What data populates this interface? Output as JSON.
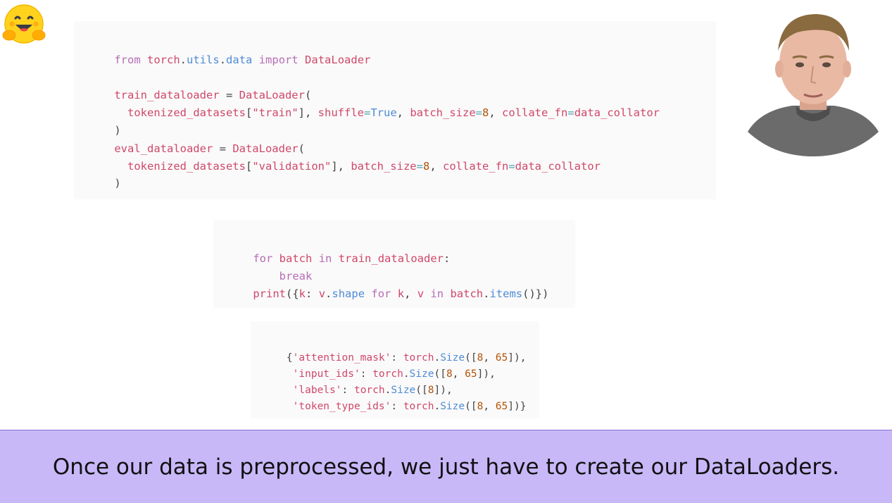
{
  "code_block_1": {
    "line1": [
      "from",
      " ",
      "torch",
      ".",
      "utils",
      ".",
      "data",
      " ",
      "import",
      " ",
      "DataLoader"
    ],
    "line2": [
      "train_dataloader",
      " = ",
      "DataLoader",
      "("
    ],
    "line3": [
      "  ",
      "tokenized_datasets",
      "[",
      "\"train\"",
      "], ",
      "shuffle",
      "=",
      "True",
      ", ",
      "batch_size",
      "=",
      "8",
      ", ",
      "collate_fn",
      "=",
      "data_collator"
    ],
    "line4": [
      ")"
    ],
    "line5": [
      "eval_dataloader",
      " = ",
      "DataLoader",
      "("
    ],
    "line6": [
      "  ",
      "tokenized_datasets",
      "[",
      "\"validation\"",
      "], ",
      "batch_size",
      "=",
      "8",
      ", ",
      "collate_fn",
      "=",
      "data_collator"
    ],
    "line7": [
      ")"
    ]
  },
  "code_block_2": {
    "line1": [
      "for",
      " ",
      "batch",
      " ",
      "in",
      " ",
      "train_dataloader",
      ":"
    ],
    "line2": [
      "    ",
      "break"
    ],
    "line3": [
      "print",
      "({",
      "k",
      ": ",
      "v",
      ".",
      "shape",
      " ",
      "for",
      " ",
      "k",
      ", ",
      "v",
      " ",
      "in",
      " ",
      "batch",
      ".",
      "items",
      "()})"
    ]
  },
  "output_block": {
    "line1": [
      "{",
      "'attention_mask'",
      ": ",
      "torch",
      ".",
      "Size",
      "([",
      "8",
      ", ",
      "65",
      "]),"
    ],
    "line2": [
      " ",
      "'input_ids'",
      ": ",
      "torch",
      ".",
      "Size",
      "([",
      "8",
      ", ",
      "65",
      "]),"
    ],
    "line3": [
      " ",
      "'labels'",
      ": ",
      "torch",
      ".",
      "Size",
      "([",
      "8",
      "]),"
    ],
    "line4": [
      " ",
      "'token_type_ids'",
      ": ",
      "torch",
      ".",
      "Size",
      "([",
      "8",
      ", ",
      "65",
      "])}"
    ]
  },
  "caption": {
    "text": "Once our data is preprocessed, we just have to create our DataLoaders."
  },
  "colors": {
    "keyword": "#b56db5",
    "variable": "#d0476a",
    "function": "#4f8bd6",
    "number": "#b45309",
    "caption_bg": "#c8b8f8"
  },
  "icons": {
    "logo": "hugging-face-emoji-icon",
    "presenter": "presenter-webcam"
  }
}
